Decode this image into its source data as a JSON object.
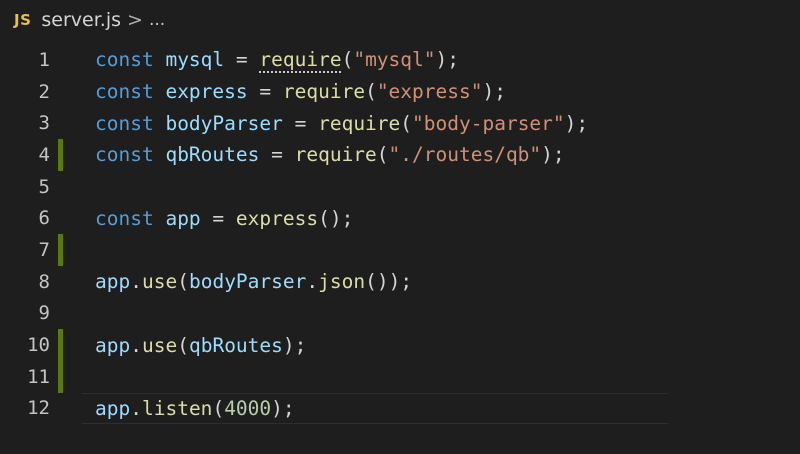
{
  "breadcrumb": {
    "file_icon": "JS",
    "file_name": "server.js",
    "separator": ">",
    "more": "..."
  },
  "editor": {
    "language": "javascript",
    "theme": "dark",
    "colors": {
      "background": "#1e1e1e",
      "keyword": "#569cd6",
      "variable": "#9cdcfe",
      "function": "#dcdcaa",
      "string": "#ce9178",
      "number": "#b5cea8",
      "gutter_added": "#587c0c"
    },
    "lines": [
      {
        "number": "1",
        "gutter": "",
        "tokens": [
          [
            "const",
            "kw"
          ],
          [
            " ",
            "punc"
          ],
          [
            "mysql",
            "var"
          ],
          [
            " = ",
            "punc"
          ],
          [
            "require",
            "fn hint"
          ],
          [
            "(",
            "punc"
          ],
          [
            "\"mysql\"",
            "str"
          ],
          [
            ");",
            "punc"
          ]
        ]
      },
      {
        "number": "2",
        "gutter": "",
        "tokens": [
          [
            "const",
            "kw"
          ],
          [
            " ",
            "punc"
          ],
          [
            "express",
            "var"
          ],
          [
            " = ",
            "punc"
          ],
          [
            "require",
            "fn"
          ],
          [
            "(",
            "punc"
          ],
          [
            "\"express\"",
            "str"
          ],
          [
            ");",
            "punc"
          ]
        ]
      },
      {
        "number": "3",
        "gutter": "",
        "tokens": [
          [
            "const",
            "kw"
          ],
          [
            " ",
            "punc"
          ],
          [
            "bodyParser",
            "var"
          ],
          [
            " = ",
            "punc"
          ],
          [
            "require",
            "fn"
          ],
          [
            "(",
            "punc"
          ],
          [
            "\"body-parser\"",
            "str"
          ],
          [
            ");",
            "punc"
          ]
        ]
      },
      {
        "number": "4",
        "gutter": "added",
        "tokens": [
          [
            "const",
            "kw"
          ],
          [
            " ",
            "punc"
          ],
          [
            "qbRoutes",
            "var"
          ],
          [
            " = ",
            "punc"
          ],
          [
            "require",
            "fn"
          ],
          [
            "(",
            "punc"
          ],
          [
            "\"./routes/qb\"",
            "str"
          ],
          [
            ");",
            "punc"
          ]
        ]
      },
      {
        "number": "5",
        "gutter": "",
        "tokens": []
      },
      {
        "number": "6",
        "gutter": "",
        "tokens": [
          [
            "const",
            "kw"
          ],
          [
            " ",
            "punc"
          ],
          [
            "app",
            "var"
          ],
          [
            " = ",
            "punc"
          ],
          [
            "express",
            "fn"
          ],
          [
            "();",
            "punc"
          ]
        ]
      },
      {
        "number": "7",
        "gutter": "added",
        "tokens": []
      },
      {
        "number": "8",
        "gutter": "",
        "tokens": [
          [
            "app",
            "var"
          ],
          [
            ".",
            "punc"
          ],
          [
            "use",
            "fn"
          ],
          [
            "(",
            "punc"
          ],
          [
            "bodyParser",
            "var"
          ],
          [
            ".",
            "punc"
          ],
          [
            "json",
            "fn"
          ],
          [
            "());",
            "punc"
          ]
        ]
      },
      {
        "number": "9",
        "gutter": "",
        "tokens": []
      },
      {
        "number": "10",
        "gutter": "added",
        "tokens": [
          [
            "app",
            "var"
          ],
          [
            ".",
            "punc"
          ],
          [
            "use",
            "fn"
          ],
          [
            "(",
            "punc"
          ],
          [
            "qbRoutes",
            "var"
          ],
          [
            ");",
            "punc"
          ]
        ]
      },
      {
        "number": "11",
        "gutter": "added",
        "tokens": []
      },
      {
        "number": "12",
        "gutter": "",
        "current": true,
        "tokens": [
          [
            "app",
            "var"
          ],
          [
            ".",
            "punc"
          ],
          [
            "listen",
            "fn"
          ],
          [
            "(",
            "punc"
          ],
          [
            "4000",
            "num"
          ],
          [
            ");",
            "punc"
          ]
        ]
      }
    ]
  }
}
